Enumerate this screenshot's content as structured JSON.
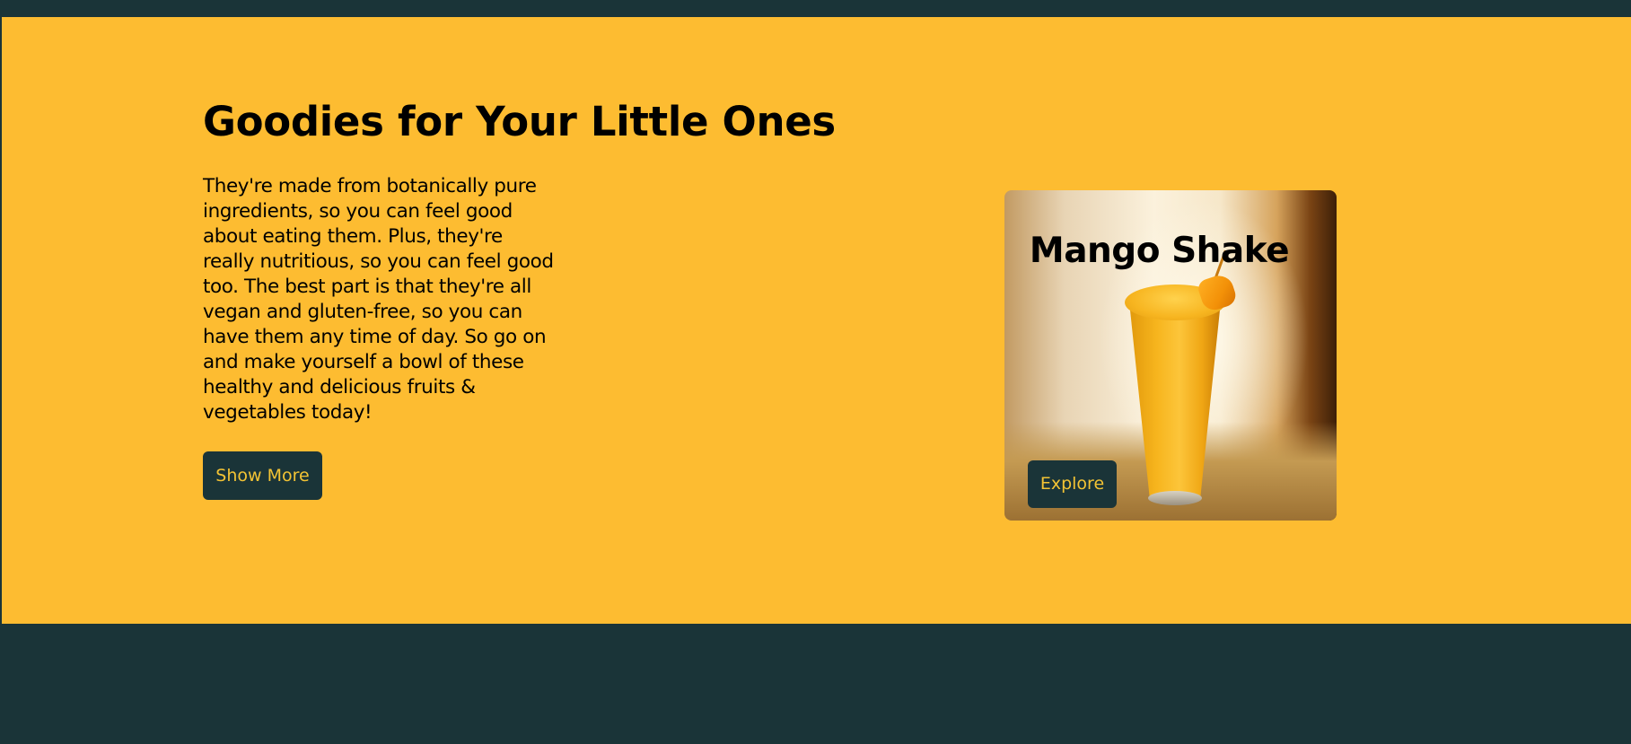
{
  "hero": {
    "heading": "Goodies for Your Little Ones",
    "description": "They're made from botanically pure ingredients, so you can feel good about eating them. Plus, they're really nutritious, so you can feel good too. The best part is that they're all vegan and gluten-free, so you can have them any time of day. So go on and make yourself a bowl of these healthy and delicious fruits & vegetables today!",
    "show_more_label": "Show More"
  },
  "card": {
    "title": "Mango Shake",
    "explore_label": "Explore"
  },
  "colors": {
    "accent": "#fdbc31",
    "dark": "#1a3438",
    "button_text": "#f3c334"
  }
}
